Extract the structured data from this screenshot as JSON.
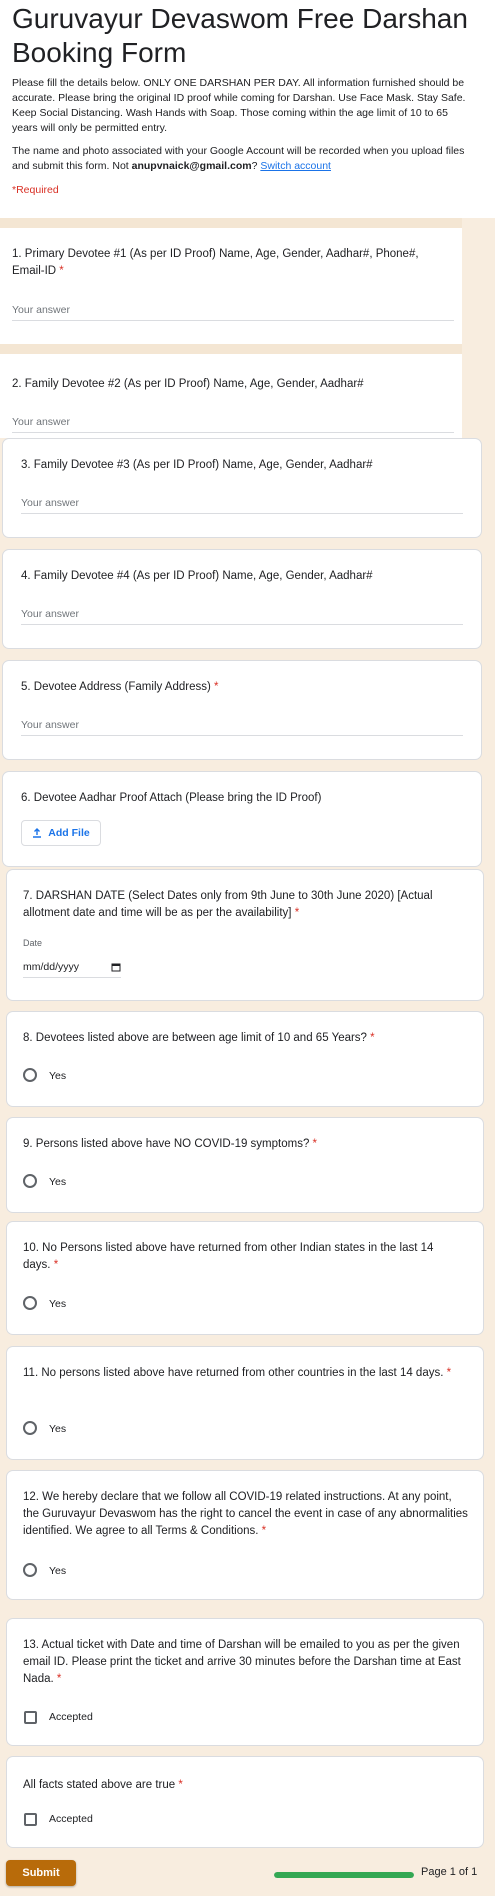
{
  "header": {
    "title": "Guruvayur Devaswom Free Darshan Booking Form",
    "description": "Please fill the details below. ONLY ONE DARSHAN PER DAY. All information furnished should be accurate. Please bring the original ID proof while coming for Darshan. Use Face Mask. Stay Safe. Keep Social Distancing. Wash Hands with Soap. Those coming within the age limit of 10 to 65 years will only be permitted entry.",
    "account_note": "The name and photo associated with your Google Account will be recorded when you upload files and submit this form. Not",
    "account_email": "anupvnaick@gmail.com",
    "account_q": "?",
    "switch_account": "Switch account",
    "required": "*Required"
  },
  "placeholders": {
    "answer": "Your answer"
  },
  "star": "*",
  "questions": {
    "q1": "1. Primary Devotee #1 (As per ID Proof) Name, Age, Gender, Aadhar#, Phone#, Email-ID",
    "q2": "2. Family Devotee #2 (As per ID Proof) Name, Age, Gender, Aadhar#",
    "q3": "3. Family Devotee #3 (As per ID Proof) Name, Age, Gender, Aadhar#",
    "q4": "4. Family Devotee #4 (As per ID Proof) Name, Age, Gender, Aadhar#",
    "q5": "5. Devotee Address (Family Address)",
    "q6": "6. Devotee Aadhar Proof Attach (Please bring the ID Proof)",
    "q7": "7. DARSHAN DATE (Select Dates only from 9th June to 30th June 2020) [Actual allotment date and time will be as per the availability]",
    "q8": "8. Devotees listed above are between age limit of 10 and 65 Years?",
    "q9": "9. Persons listed above have NO COVID-19 symptoms?",
    "q10": "10. No Persons listed above have returned from other Indian states in the last 14 days.",
    "q11": "11. No persons listed above have returned from other countries in the last 14 days.",
    "q12": "12. We hereby declare that we follow all COVID-19 related instructions. At any point, the Guruvayur Devaswom has the right to cancel the event in case of any abnormalities identified. We agree to all Terms & Conditions.",
    "q13": "13. Actual ticket with Date and time of Darshan will be emailed to you as per the given email ID. Please print the ticket and arrive 30 minutes before the Darshan time at East Nada.",
    "q14": "All facts stated above are true"
  },
  "controls": {
    "add_file": "Add File",
    "date_label": "Date",
    "date_placeholder": "mm/dd/yyyy",
    "yes": "Yes",
    "accepted": "Accepted"
  },
  "footer": {
    "submit": "Submit",
    "page": "Page 1 of 1",
    "progress": 1.0
  },
  "colors": {
    "accent": "#b86b0a",
    "required": "#d93025",
    "progress": "#34a853",
    "background": "#f8eddf"
  }
}
